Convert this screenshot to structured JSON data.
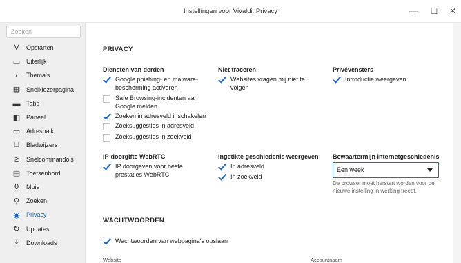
{
  "window": {
    "title": "Instellingen voor Vivaldi: Privacy",
    "minimize": "—",
    "maximize": "☐",
    "close": "✕"
  },
  "sidebar": {
    "search_placeholder": "Zoeken",
    "items": [
      {
        "label": "Opstarten",
        "icon": "vivaldi-v-icon",
        "glyph": "V"
      },
      {
        "label": "Uiterlijk",
        "icon": "window-icon",
        "glyph": "▭"
      },
      {
        "label": "Thema's",
        "icon": "brush-icon",
        "glyph": "/"
      },
      {
        "label": "Snelkiezerpagina",
        "icon": "grid-icon",
        "glyph": "▦"
      },
      {
        "label": "Tabs",
        "icon": "tabs-icon",
        "glyph": "▬"
      },
      {
        "label": "Paneel",
        "icon": "panel-icon",
        "glyph": "◧"
      },
      {
        "label": "Adresbalk",
        "icon": "addressbar-icon",
        "glyph": "▭"
      },
      {
        "label": "Bladwijzers",
        "icon": "bookmark-icon",
        "glyph": "⎕"
      },
      {
        "label": "Snelcommando's",
        "icon": "quick-commands-icon",
        "glyph": "≥"
      },
      {
        "label": "Toetsenbord",
        "icon": "keyboard-icon",
        "glyph": "▤"
      },
      {
        "label": "Muis",
        "icon": "mouse-icon",
        "glyph": "θ"
      },
      {
        "label": "Zoeken",
        "icon": "search-icon",
        "glyph": "⚲"
      },
      {
        "label": "Privacy",
        "icon": "eye-icon",
        "glyph": "◉",
        "active": true
      },
      {
        "label": "Updates",
        "icon": "refresh-icon",
        "glyph": "↻"
      },
      {
        "label": "Downloads",
        "icon": "download-icon",
        "glyph": "⤓"
      }
    ]
  },
  "privacy": {
    "heading": "PRIVACY",
    "third_party": {
      "heading": "Diensten van derden",
      "options": [
        {
          "label": "Google phishing- en malware-bescherming activeren",
          "checked": true
        },
        {
          "label": "Safe Browsing-incidenten aan Google melden",
          "checked": false
        },
        {
          "label": "Zoeken in adresveld inschakelen",
          "checked": true
        },
        {
          "label": "Zoeksuggesties in adresveld",
          "checked": false
        },
        {
          "label": "Zoeksuggesties in zoekveld",
          "checked": false
        }
      ]
    },
    "no_tracking": {
      "heading": "Niet traceren",
      "options": [
        {
          "label": "Websites vragen mij niet te volgen",
          "checked": true
        }
      ]
    },
    "private_windows": {
      "heading": "Privévensters",
      "options": [
        {
          "label": "Introductie weergeven",
          "checked": true
        }
      ]
    },
    "webrtc": {
      "heading": "IP-doorgifte WebRTC",
      "options": [
        {
          "label": "IP doorgeven voor beste prestaties WebRTC",
          "checked": true
        }
      ]
    },
    "typed_history": {
      "heading": "Ingetikte geschiedenis weergeven",
      "options": [
        {
          "label": "In adresveld",
          "checked": true
        },
        {
          "label": "In zoekveld",
          "checked": true
        }
      ]
    },
    "history_retention": {
      "heading": "Bewaartermijn internetgeschiedenis",
      "selected": "Een week",
      "note": "De browser moet herstart worden voor de nieuwe instelling in werking treedt."
    }
  },
  "passwords": {
    "heading": "WACHTWOORDEN",
    "save_option": {
      "label": "Wachtwoorden van webpagina's opslaan",
      "checked": true
    },
    "columns": {
      "website": "Website",
      "account": "Accountnaam"
    }
  },
  "colors": {
    "accent": "#1e69c7",
    "sidebar_bg": "#efefef"
  }
}
